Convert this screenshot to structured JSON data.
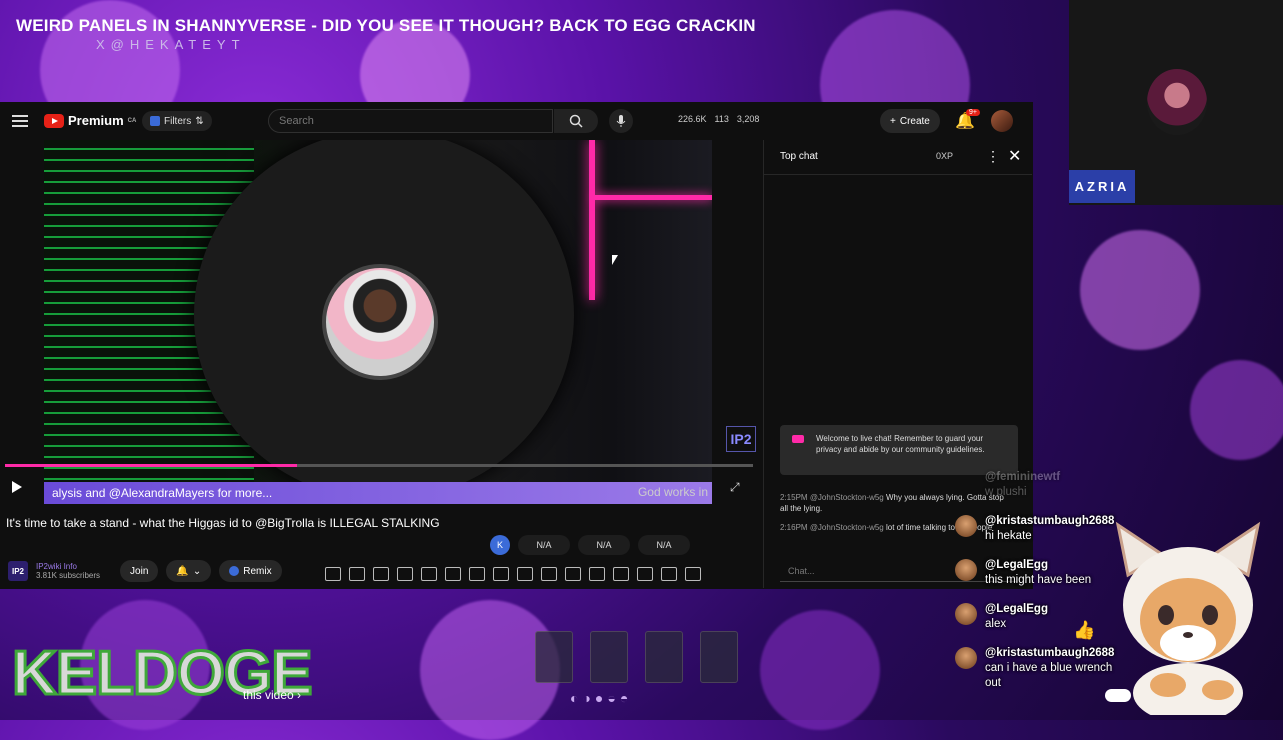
{
  "stream": {
    "title": "WEIRD PANELS IN SHANNYVERSE - DID YOU SEE IT THOUGH? BACK TO EGG CRACKIN",
    "subtitle": "X@HEKATEYT"
  },
  "youtube": {
    "logo_label": "Premium",
    "logo_region": "CA",
    "filters_label": "Filters",
    "search_placeholder": "Search",
    "stats": [
      "226.6K",
      "113",
      "3,208"
    ],
    "create_label": "Create",
    "notification_badge": "9+"
  },
  "video": {
    "ticker_text": "alysis and @AlexandraMayers for more...",
    "ticker_right": "God works in",
    "progress": 0.39,
    "watermark": "IP2",
    "title": "It's time to take a stand - what the Higgas id to @BigTrolla is ILLEGAL STALKING",
    "channel_logo": "IP2",
    "channel_name": "IP2wiki Info",
    "subscribers": "3.81K subscribers",
    "join_label": "Join",
    "remix_label": "Remix",
    "na_values": [
      "N/A",
      "N/A",
      "N/A"
    ],
    "k_badge": "K"
  },
  "chat": {
    "header": "Top chat",
    "xp": "0XP",
    "welcome": "Welcome to live chat! Remember to guard your privacy and abide by our community guidelines.",
    "messages": [
      {
        "time": "2:15PM",
        "author": "@JohnStockton-w5g",
        "text": "Why you always lying. Gotta stop all the lying."
      },
      {
        "time": "2:16PM",
        "author": "@JohnStockton-w5g",
        "text": "lot of time talking to 10 people"
      }
    ],
    "input_placeholder": "Chat..."
  },
  "cam": {
    "name": "AZRIA"
  },
  "overlay_chat": [
    {
      "user": "@kristastumbaugh2688",
      "text": "hi hekate"
    },
    {
      "user": "@LegalEgg",
      "text": "this might have been"
    },
    {
      "user": "@LegalEgg",
      "text": "alex"
    },
    {
      "user": "@kristastumbaugh2688",
      "text": "can i have a blue wrench out"
    }
  ],
  "overlay_faded": {
    "user": "@femininewtf",
    "text": "w plushi"
  },
  "brand": {
    "keldoge": "KELDOGE"
  },
  "bottom": {
    "this_video": "this video"
  }
}
